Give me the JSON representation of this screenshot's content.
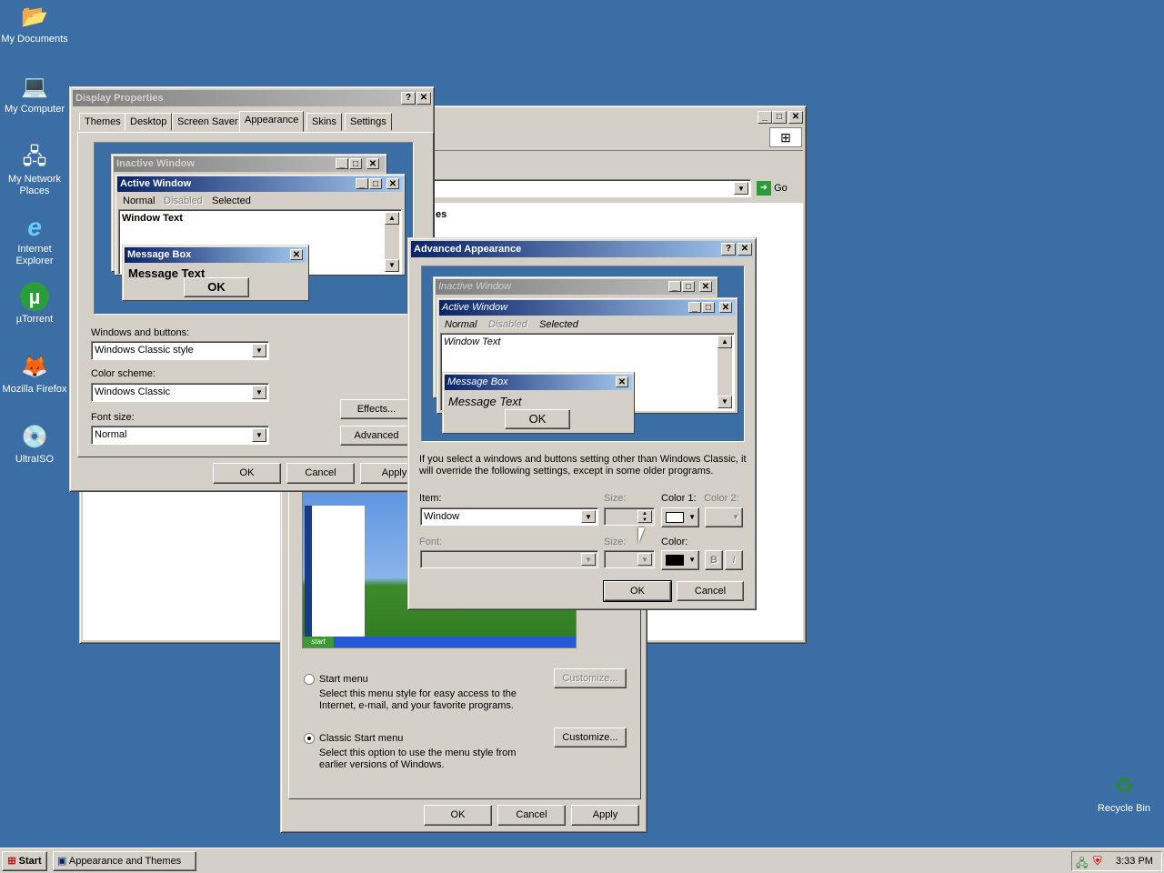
{
  "desktop": {
    "icons": [
      {
        "label": "My Documents",
        "glyph": "📂"
      },
      {
        "label": "My Computer",
        "glyph": "💻"
      },
      {
        "label": "My Network Places",
        "glyph": "🖧"
      },
      {
        "label": "Internet Explorer",
        "glyph": "e"
      },
      {
        "label": "µTorrent",
        "glyph": "µ"
      },
      {
        "label": "Mozilla Firefox",
        "glyph": "🦊"
      },
      {
        "label": "UltraISO",
        "glyph": "💿"
      },
      {
        "label": "Recycle Bin",
        "glyph": "♻"
      }
    ]
  },
  "bg_window": {
    "go_label": "Go",
    "partial_text": "es"
  },
  "taskbar_props": {
    "start_menu_label": "Start menu",
    "start_menu_desc": "Select this menu style for easy access to the Internet, e-mail, and your favorite programs.",
    "classic_label": "Classic Start menu",
    "classic_desc": "Select this option to use the menu style from earlier versions of Windows.",
    "customize1": "Customize...",
    "customize2": "Customize...",
    "ok": "OK",
    "cancel": "Cancel",
    "apply": "Apply",
    "preview_start": "start"
  },
  "display_props": {
    "title": "Display Properties",
    "tabs": [
      "Themes",
      "Desktop",
      "Screen Saver",
      "Appearance",
      "Skins",
      "Settings"
    ],
    "selected_tab": "Appearance",
    "preview": {
      "inactive_title": "Inactive Window",
      "active_title": "Active Window",
      "menu_normal": "Normal",
      "menu_disabled": "Disabled",
      "menu_selected": "Selected",
      "window_text": "Window Text",
      "msgbox_title": "Message Box",
      "msgbox_text": "Message Text",
      "ok": "OK"
    },
    "windows_buttons_label": "Windows and buttons:",
    "windows_buttons_value": "Windows Classic style",
    "color_scheme_label": "Color scheme:",
    "color_scheme_value": "Windows Classic",
    "font_size_label": "Font size:",
    "font_size_value": "Normal",
    "effects": "Effects...",
    "advanced": "Advanced",
    "ok": "OK",
    "cancel": "Cancel",
    "apply": "Apply"
  },
  "advanced": {
    "title": "Advanced Appearance",
    "preview": {
      "inactive_title": "Inactive Window",
      "active_title": "Active Window",
      "menu_normal": "Normal",
      "menu_disabled": "Disabled",
      "menu_selected": "Selected",
      "window_text": "Window Text",
      "msgbox_title": "Message Box",
      "msgbox_text": "Message Text",
      "ok": "OK"
    },
    "info": "If you select a windows and buttons setting other than Windows Classic, it will override the following settings, except in some older programs.",
    "item_label": "Item:",
    "item_value": "Window",
    "size_label": "Size:",
    "color1_label": "Color 1:",
    "color2_label": "Color 2:",
    "font_label": "Font:",
    "size2_label": "Size:",
    "color_label": "Color:",
    "bold": "B",
    "italic": "I",
    "ok": "OK",
    "cancel": "Cancel"
  },
  "taskbar": {
    "start": "Start",
    "task_label": "Appearance and Themes",
    "clock": "3:33 PM"
  },
  "colors": {
    "desktop": "#3a6ea5",
    "active_title": "#0a246a",
    "inactive_title": "#808080",
    "face": "#d4d0c8"
  }
}
